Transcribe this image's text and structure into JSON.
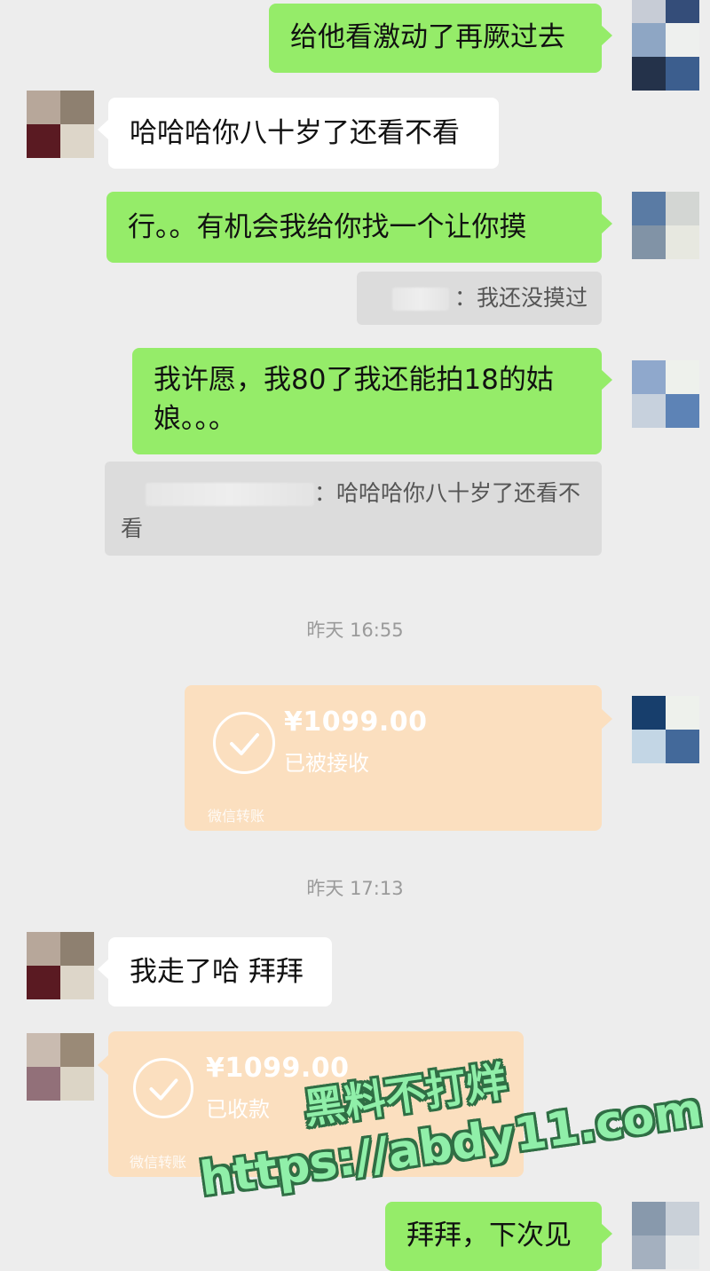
{
  "messages": {
    "m1": "给他看激动了再厥过去",
    "m2": "哈哈哈你八十岁了还看不看",
    "m3": "行。。有机会我给你找一个让你摸",
    "q1": "：我还没摸过",
    "m4_line1": "我许愿，我80了我还能拍18的姑",
    "m4_line2": "娘。。。",
    "q2_line1": "：哈哈哈你八十岁了还看不",
    "q2_line2": "看",
    "m5": "我走了哈 拜拜",
    "m6": "拜拜，下次见"
  },
  "timestamps": {
    "t1": "昨天 16:55",
    "t2": "昨天 17:13"
  },
  "transfers": {
    "sent": {
      "amount": "¥1099.00",
      "status": "已被接收",
      "label": "微信转账"
    },
    "received": {
      "amount": "¥1099.00",
      "status": "已收款",
      "label": "微信转账"
    }
  },
  "watermark": {
    "line1": "黑料不打烊",
    "line2": "https://abdy11.com"
  },
  "colors": {
    "background": "#ededed",
    "green_bubble": "#95ec69",
    "white_bubble": "#ffffff",
    "transfer_card": "#fbdfbf",
    "quote_box": "#dcdcdc"
  }
}
